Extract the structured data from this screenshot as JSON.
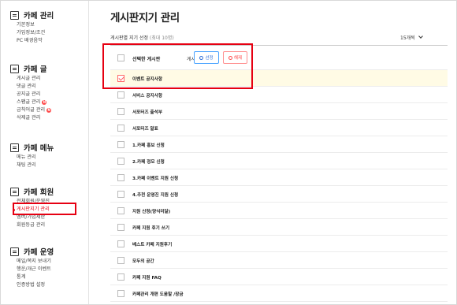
{
  "sidebar": {
    "sections": [
      {
        "title": "카페 관리",
        "icon": "settings-icon",
        "items": [
          {
            "label": "기본정보"
          },
          {
            "label": "가입정보/조건"
          },
          {
            "label": "PC 배경음악"
          }
        ]
      },
      {
        "title": "카페 글",
        "icon": "document-icon",
        "items": [
          {
            "label": "게시글 관리"
          },
          {
            "label": "댓글 관리"
          },
          {
            "label": "공지글 관리"
          },
          {
            "label": "스팸글 관리",
            "badge": "N"
          },
          {
            "label": "금칙어글 관리",
            "badge": "N"
          },
          {
            "label": "삭제글 관리"
          }
        ]
      },
      {
        "title": "카페 메뉴",
        "icon": "menu-icon",
        "items": [
          {
            "label": "메뉴 관리"
          },
          {
            "label": "채팅 관리"
          }
        ]
      },
      {
        "title": "카페 회원",
        "icon": "members-icon",
        "items": [
          {
            "label": "전체회원/운영진"
          },
          {
            "label": "게시판지기 관리",
            "active": true
          },
          {
            "label": "멤버/가입제한"
          },
          {
            "label": "회원등급 관리"
          }
        ]
      },
      {
        "title": "카페 운영",
        "icon": "operation-icon",
        "items": [
          {
            "label": "메일/쪽지 보내기"
          },
          {
            "label": "행운/개근 이벤트"
          },
          {
            "label": "통계"
          },
          {
            "label": "인증방법 설정"
          }
        ]
      }
    ]
  },
  "main": {
    "title": "게시판지기 관리",
    "toolbar": {
      "label": "게시판별 지기 선정",
      "hint": "(최대 10명)",
      "per_page": "15개씩"
    },
    "header_row": {
      "label": "선택한 게시판",
      "sub_label": "게시판 지기",
      "select_button": "선정",
      "cancel_button": "해제"
    },
    "boards": [
      {
        "name": "이벤트 공지사항",
        "checked": true
      },
      {
        "name": "서비스 공지사항"
      },
      {
        "name": "서포터즈 출석부"
      },
      {
        "name": "서포터즈 알표"
      },
      {
        "name": "1.카페 홍보 신청"
      },
      {
        "name": "2.카페 정모 신청"
      },
      {
        "name": "3.카페 이벤트 지원 신청"
      },
      {
        "name": "4.추천 운영진 지원 신청"
      },
      {
        "name": "지원 신청(양식미달)"
      },
      {
        "name": "카페 지원 후기 쓰기"
      },
      {
        "name": "베스트 카페 지원후기"
      },
      {
        "name": "모두의 공간"
      },
      {
        "name": "카페 지원 FAQ"
      },
      {
        "name": "카페관리 개편 도움말 /장금"
      }
    ]
  },
  "colors": {
    "accent_red": "#e60012",
    "select_blue": "#4aa3ff",
    "selected_row_bg": "#fffbe5"
  }
}
